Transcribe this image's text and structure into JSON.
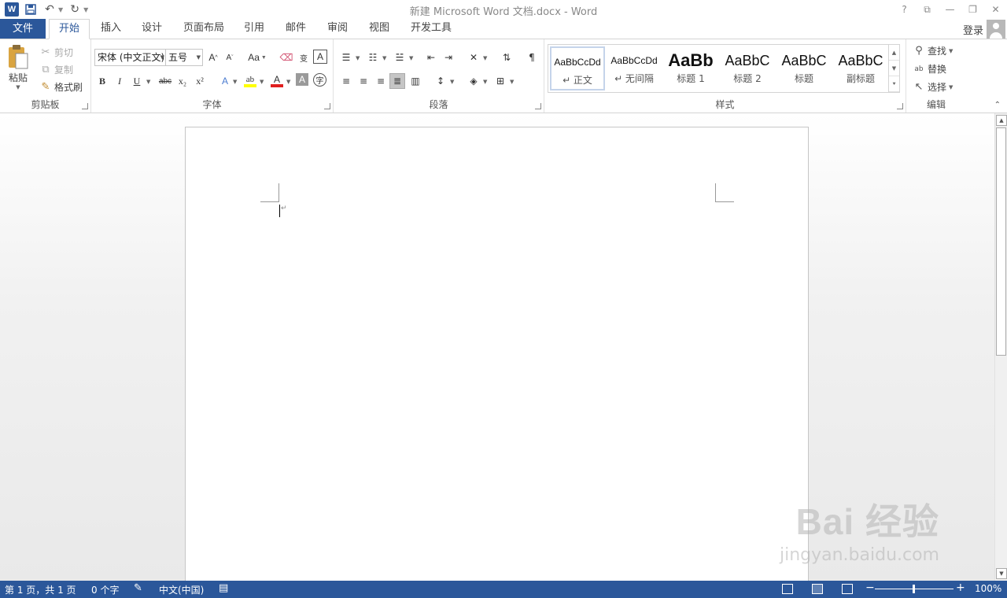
{
  "window": {
    "title": "新建 Microsoft Word 文档.docx - Word",
    "help": "?",
    "controls": [
      "⧉",
      "—",
      "❐",
      "✕"
    ]
  },
  "quick_access": {
    "logo": "W",
    "save_icon": "save-icon",
    "undo_icon": "undo-icon",
    "redo_icon": "redo-icon",
    "customize_icon": "customize-icon"
  },
  "tabs": {
    "file": "文件",
    "items": [
      "开始",
      "插入",
      "设计",
      "页面布局",
      "引用",
      "邮件",
      "审阅",
      "视图",
      "开发工具"
    ],
    "active": "开始"
  },
  "account": {
    "login": "登录"
  },
  "ribbon": {
    "clipboard": {
      "label": "剪贴板",
      "paste": "粘贴",
      "cut": "剪切",
      "copy": "复制",
      "format_painter": "格式刷"
    },
    "font": {
      "label": "字体",
      "font_name": "宋体 (中文正文)",
      "font_size": "五号",
      "grow": "A",
      "shrink": "A",
      "change_case": "Aa",
      "bold": "B",
      "italic": "I",
      "underline": "U",
      "strikethrough": "abc",
      "subscript": "x₂",
      "superscript": "x²",
      "highlight_color": "#ffff00",
      "font_color": "#e02020"
    },
    "paragraph": {
      "label": "段落"
    },
    "styles": {
      "label": "样式",
      "items": [
        {
          "sample": "AaBbCcDd",
          "name": "↵ 正文",
          "selected": true
        },
        {
          "sample": "AaBbCcDd",
          "name": "↵ 无间隔",
          "selected": false
        },
        {
          "sample": "AaBb",
          "name": "标题 1",
          "selected": false
        },
        {
          "sample": "AaBbC",
          "name": "标题 2",
          "selected": false
        },
        {
          "sample": "AaBbC",
          "name": "标题",
          "selected": false
        },
        {
          "sample": "AaBbC",
          "name": "副标题",
          "selected": false
        }
      ]
    },
    "editing": {
      "label": "编辑",
      "find": "查找",
      "replace": "替换",
      "select": "选择"
    }
  },
  "watermark": {
    "main": "Bai 经验",
    "url": "jingyan.baidu.com"
  },
  "status": {
    "page": "第 1 页，共 1 页",
    "words": "0 个字",
    "language": "中文(中国)",
    "zoom": "100%",
    "zoom_minus": "−",
    "zoom_plus": "+"
  },
  "colors": {
    "accent": "#2b579a"
  }
}
